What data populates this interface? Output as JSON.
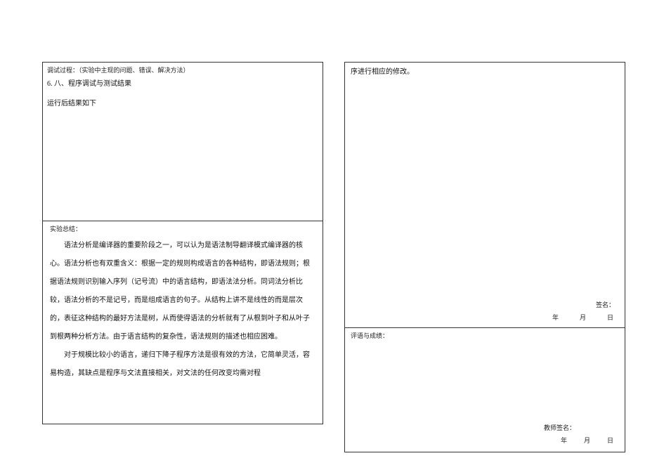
{
  "left": {
    "top": {
      "header": "调试过程：（实验中主现的问题、错误、解决方法）",
      "line_num": "6.  八、程序调试与测试结果",
      "result_heading": "运行后结果如下"
    },
    "bottom": {
      "header": "实验总结：",
      "para1": "语法分析是编译器的重要阶段之一，可以认为是语法制导翻译模式编译器的核心。语法分析也有双重含义：根据一定的规则构成语言的各种结构，即语法规则；根据语法规则识别输入序列（记号流）中的语言结构，即语法法分析。同词法分析比较，语法分析的不是记号，而是组成语言的句子。从结构上讲不是线性的而是层次的，表征这种结构的最好方法是树，从而使得语法的分析就有了从根到叶子和从叶子到根两种分析方法。由于语言结构的复杂性，语法规则的描述也相应困难。",
      "para2": "对于规模比较小的语言，递归下降子程序方法是很有效的方法，它简单灵活，容易构造，其缺点是程序与文法直接相关，对文法的任何改变均需对程"
    }
  },
  "right": {
    "top": {
      "continuation": "序进行相应的修改。",
      "signature_label": "签名：",
      "date": {
        "y": "年",
        "m": "月",
        "d": "日"
      }
    },
    "bottom": {
      "header": "评语与成绩：",
      "teacher_signature_label": "教师签名：",
      "date": {
        "y": "年",
        "m": "月",
        "d": "日"
      }
    }
  }
}
